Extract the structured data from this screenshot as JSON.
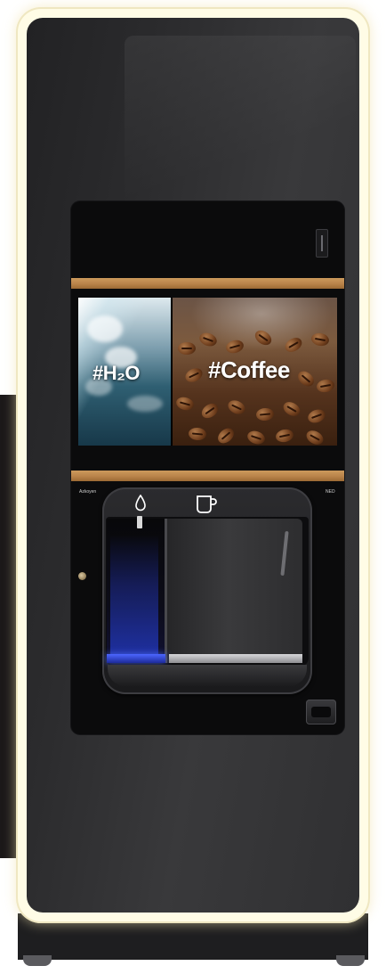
{
  "screen": {
    "left_tag": "#H₂O",
    "right_tag": "#Coffee"
  },
  "panel": {
    "brand": "Azkoyen",
    "locale": "NED"
  },
  "icons": {
    "water": "water-drop-icon",
    "coffee": "cup-icon"
  },
  "colors": {
    "frame_glow": "#fffce6",
    "brass_strip": "#b9834a",
    "water_light": "#4c66ff",
    "cabinet": "#2b2b2d"
  }
}
